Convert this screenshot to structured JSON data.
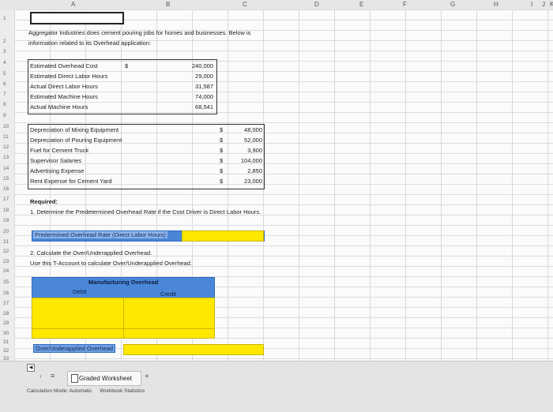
{
  "columns": [
    "A",
    "B",
    "C",
    "D",
    "E",
    "F",
    "G",
    "H",
    "I",
    "J",
    "K"
  ],
  "rows": [
    "1",
    "2",
    "3",
    "4",
    "5",
    "6",
    "7",
    "8",
    "9",
    "10",
    "11",
    "12",
    "13",
    "14",
    "15",
    "16",
    "17",
    "18",
    "19",
    "20",
    "21",
    "22",
    "23",
    "24",
    "25",
    "26",
    "27",
    "28",
    "29",
    "30",
    "31",
    "32",
    "33"
  ],
  "intro": {
    "line1": "Aggregator Industries does cement pouring jobs for homes and businesses. Below is",
    "line2": "information related to its Overhead application:"
  },
  "estimates": [
    {
      "label": "Estimated Overhead Cost",
      "currency": "$",
      "value": "240,000"
    },
    {
      "label": "Estimated Direct Labor Hours",
      "currency": "",
      "value": "29,000"
    },
    {
      "label": "Actual Direct Labor Hours",
      "currency": "",
      "value": "31,587"
    },
    {
      "label": "Estimated Machine Hours",
      "currency": "",
      "value": "74,000"
    },
    {
      "label": "Actual Machine Hours",
      "currency": "",
      "value": "68,541"
    }
  ],
  "expenses": [
    {
      "label": "Depreciation of Mixing Equipment",
      "currency": "$",
      "value": "48,000"
    },
    {
      "label": "Depreciation of Pouring Equipment",
      "currency": "$",
      "value": "52,000"
    },
    {
      "label": "Fuel for Cement Truck",
      "currency": "$",
      "value": "3,900"
    },
    {
      "label": "Supervisor Salaries",
      "currency": "$",
      "value": "104,000"
    },
    {
      "label": "Advertising Expense",
      "currency": "$",
      "value": "2,850"
    },
    {
      "label": "Rent Expense for Cement Yard",
      "currency": "$",
      "value": "23,000"
    }
  ],
  "required": {
    "heading": "Required:",
    "q1": "1. Determine the Predetermined Overhead Rate if the Cost Driver is Direct Labor Hours.",
    "rate_label": "Predermined Overhead Rate (Direct Labor Hours)",
    "q2a": "2. Calculate the Over/Underapplied Overhead.",
    "q2b": "Use this T-Account to calculate Over/Underapplied Overhead."
  },
  "taccount": {
    "title": "Manufacturing Overhead",
    "debit": "Debit",
    "credit": "Credit",
    "over_under_label": "Over/Underapplied Overhead"
  },
  "sheet_tabs": {
    "active": "Graded Worksheet",
    "add": "+",
    "menu_glyph": "≡"
  },
  "status": {
    "calc_mode": "Calculation Mode: Automatic",
    "stats": "Workbook Statistics"
  },
  "colors": {
    "header_blue": "#4a86d6",
    "input_yellow": "#ffe800"
  }
}
